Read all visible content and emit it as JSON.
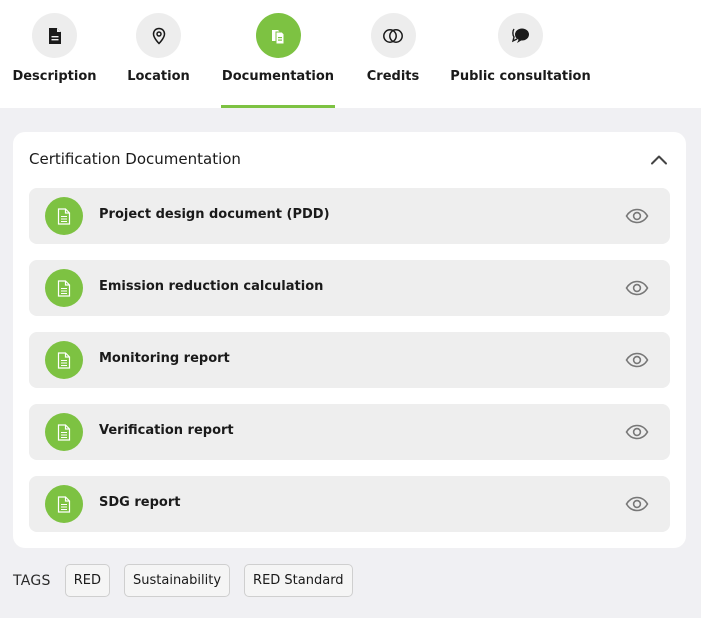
{
  "tabs": [
    {
      "label": "Description",
      "icon": "document-icon",
      "active": false
    },
    {
      "label": "Location",
      "icon": "location-pin-icon",
      "active": false
    },
    {
      "label": "Documentation",
      "icon": "documents-icon",
      "active": true
    },
    {
      "label": "Credits",
      "icon": "credits-icon",
      "active": false
    },
    {
      "label": "Public consultation",
      "icon": "chat-bubbles-icon",
      "active": false
    }
  ],
  "section": {
    "title": "Certification Documentation",
    "collapse_icon": "chevron-up-icon",
    "documents": [
      {
        "label": "Project design document (PDD)",
        "icon": "file-text-icon",
        "action_icon": "eye-icon"
      },
      {
        "label": "Emission reduction calculation",
        "icon": "file-text-icon",
        "action_icon": "eye-icon"
      },
      {
        "label": "Monitoring report",
        "icon": "file-text-icon",
        "action_icon": "eye-icon"
      },
      {
        "label": "Verification report",
        "icon": "file-text-icon",
        "action_icon": "eye-icon"
      },
      {
        "label": "SDG report",
        "icon": "file-text-icon",
        "action_icon": "eye-icon"
      }
    ]
  },
  "tags": {
    "label": "TAGS",
    "items": [
      "RED",
      "Sustainability",
      "RED Standard"
    ]
  },
  "colors": {
    "accent": "#7dc242",
    "row_bg": "#eeeeee",
    "page_bg": "#f0f0f3"
  }
}
